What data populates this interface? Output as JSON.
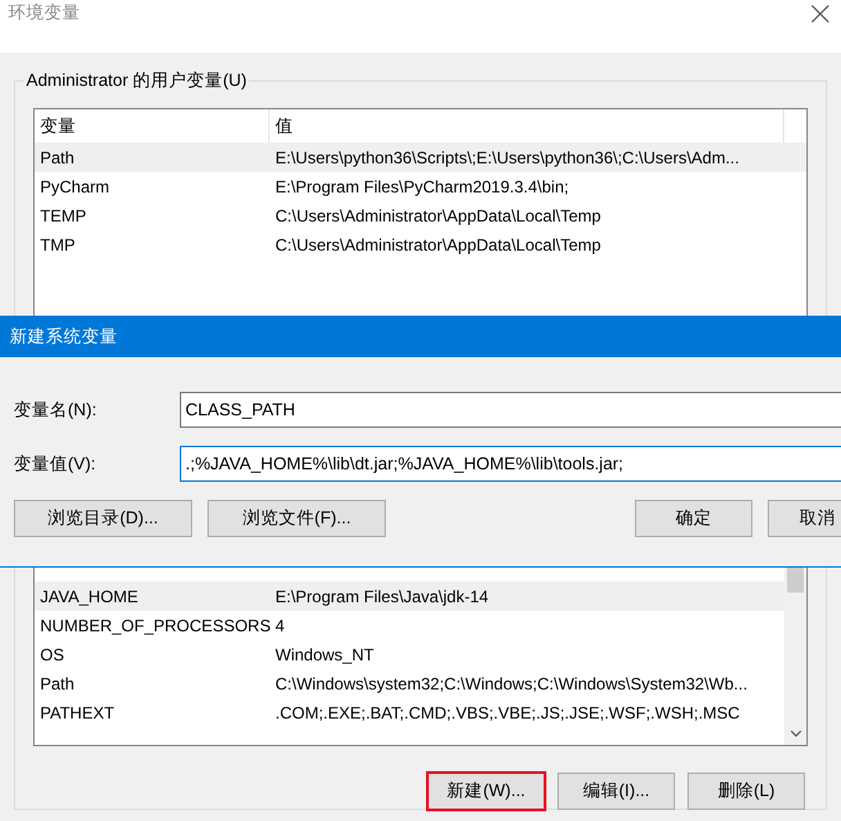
{
  "window": {
    "title": "环境变量"
  },
  "user_variables": {
    "label": "Administrator 的用户变量(U)",
    "columns": [
      "变量",
      "值"
    ],
    "rows": [
      {
        "name": "Path",
        "value": "E:\\Users\\python36\\Scripts\\;E:\\Users\\python36\\;C:\\Users\\Adm...",
        "selected": true
      },
      {
        "name": "PyCharm",
        "value": "E:\\Program Files\\PyCharm2019.3.4\\bin;",
        "selected": false
      },
      {
        "name": "TEMP",
        "value": "C:\\Users\\Administrator\\AppData\\Local\\Temp",
        "selected": false
      },
      {
        "name": "TMP",
        "value": "C:\\Users\\Administrator\\AppData\\Local\\Temp",
        "selected": false
      }
    ]
  },
  "system_variables": {
    "rows": [
      {
        "name": "JAVA_HOME",
        "value": "E:\\Program Files\\Java\\jdk-14",
        "selected": true
      },
      {
        "name": "NUMBER_OF_PROCESSORS",
        "value": "4",
        "selected": false
      },
      {
        "name": "OS",
        "value": "Windows_NT",
        "selected": false
      },
      {
        "name": "Path",
        "value": "C:\\Windows\\system32;C:\\Windows;C:\\Windows\\System32\\Wb...",
        "selected": false
      },
      {
        "name": "PATHEXT",
        "value": ".COM;.EXE;.BAT;.CMD;.VBS;.VBE;.JS;.JSE;.WSF;.WSH;.MSC",
        "selected": false
      }
    ],
    "buttons": [
      {
        "label": "新建(W)...",
        "highlighted": true
      },
      {
        "label": "编辑(I)...",
        "highlighted": false
      },
      {
        "label": "删除(L)",
        "highlighted": false
      }
    ]
  },
  "dialog": {
    "title": "新建系统变量",
    "fields": [
      {
        "label": "变量名(N):",
        "value": "CLASS_PATH",
        "focused": false
      },
      {
        "label": "变量值(V):",
        "value": ".;%JAVA_HOME%\\lib\\dt.jar;%JAVA_HOME%\\lib\\tools.jar;",
        "focused": true
      }
    ],
    "left_buttons": [
      "浏览目录(D)...",
      "浏览文件(F)..."
    ],
    "right_buttons": [
      "确定",
      "取消"
    ]
  }
}
